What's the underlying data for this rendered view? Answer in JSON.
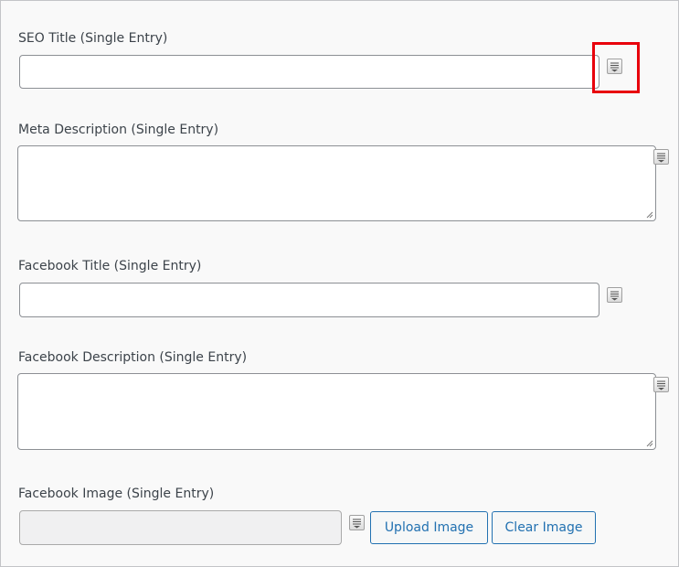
{
  "fields": {
    "seo_title": {
      "label": "SEO Title (Single Entry)",
      "value": ""
    },
    "meta_description": {
      "label": "Meta Description (Single Entry)",
      "value": ""
    },
    "facebook_title": {
      "label": "Facebook Title (Single Entry)",
      "value": ""
    },
    "facebook_description": {
      "label": "Facebook Description (Single Entry)",
      "value": ""
    },
    "facebook_image": {
      "label": "Facebook Image (Single Entry)",
      "value": ""
    }
  },
  "buttons": {
    "upload_image": "Upload Image",
    "clear_image": "Clear Image"
  },
  "icons": {
    "insert_variable": "insert-variable-icon"
  },
  "colors": {
    "highlight": "#e8000b",
    "button_accent": "#2271b1"
  }
}
